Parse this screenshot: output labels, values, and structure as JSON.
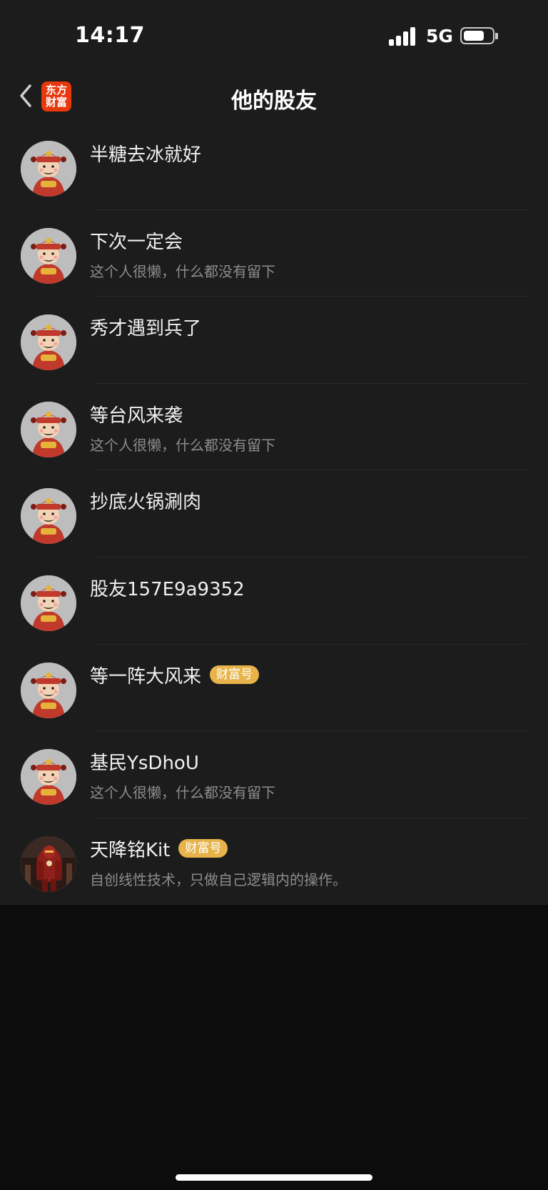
{
  "status_bar": {
    "time": "14:17",
    "network": "5G",
    "battery_level": 0.6
  },
  "nav": {
    "title": "他的股友",
    "app_logo_line1": "东方",
    "app_logo_line2": "财富",
    "back_icon": "chevron-left-icon"
  },
  "colors": {
    "badge": "#e7b34a",
    "logo": "#e8380d",
    "list_bg": "#1c1c1c",
    "page_bg": "#0c0c0c"
  },
  "users": [
    {
      "name": "半糖去冰就好",
      "bio": "",
      "badge": "",
      "avatar": "caishen-avatar"
    },
    {
      "name": "下次一定会",
      "bio": "这个人很懒，什么都没有留下",
      "badge": "",
      "avatar": "caishen-avatar"
    },
    {
      "name": "秀才遇到兵了",
      "bio": "",
      "badge": "",
      "avatar": "caishen-avatar"
    },
    {
      "name": "等台风来袭",
      "bio": "这个人很懒，什么都没有留下",
      "badge": "",
      "avatar": "caishen-avatar"
    },
    {
      "name": "抄底火锅涮肉",
      "bio": "",
      "badge": "",
      "avatar": "caishen-avatar"
    },
    {
      "name": "股友157E9a9352",
      "bio": "",
      "badge": "",
      "avatar": "caishen-avatar"
    },
    {
      "name": "等一阵大风来",
      "bio": "",
      "badge": "财富号",
      "avatar": "caishen-avatar"
    },
    {
      "name": "基民YsDhoU",
      "bio": "这个人很懒，什么都没有留下",
      "badge": "",
      "avatar": "caishen-avatar"
    },
    {
      "name": "天降铭Kit",
      "bio": "自创线性技术，只做自己逻辑内的操作。",
      "badge": "财富号",
      "avatar": "red-armor-photo-avatar"
    }
  ]
}
